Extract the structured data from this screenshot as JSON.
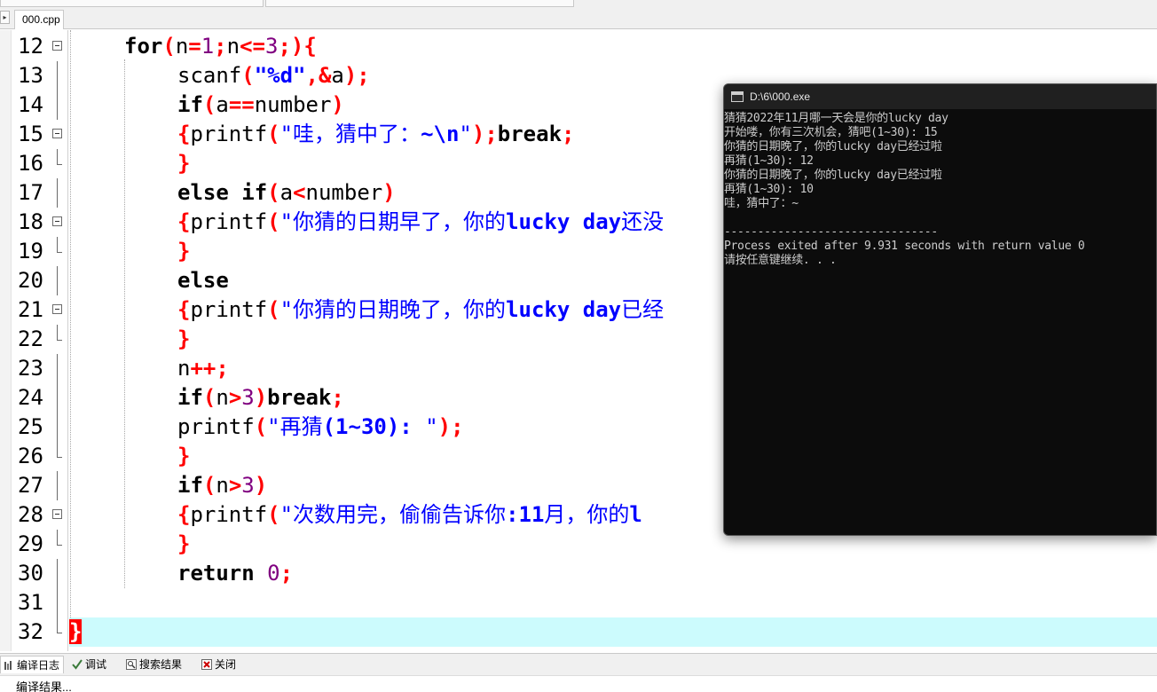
{
  "editor": {
    "file_tab": "000.cpp",
    "lines": [
      {
        "n": "12"
      },
      {
        "n": "13"
      },
      {
        "n": "14"
      },
      {
        "n": "15"
      },
      {
        "n": "16"
      },
      {
        "n": "17"
      },
      {
        "n": "18"
      },
      {
        "n": "19"
      },
      {
        "n": "20"
      },
      {
        "n": "21"
      },
      {
        "n": "22"
      },
      {
        "n": "23"
      },
      {
        "n": "24"
      },
      {
        "n": "25"
      },
      {
        "n": "26"
      },
      {
        "n": "27"
      },
      {
        "n": "28"
      },
      {
        "n": "29"
      },
      {
        "n": "30"
      },
      {
        "n": "31"
      },
      {
        "n": "32"
      }
    ],
    "code": {
      "l12_for": "for",
      "l12_open": "(",
      "l12_n": "n",
      "l12_eq": "=",
      "l12_1": "1",
      "l12_semi1": ";",
      "l12_n2": "n",
      "l12_le": "<=",
      "l12_3": "3",
      "l12_semi2": ";)",
      "l12_brace": "{",
      "l13_scanf": "scanf",
      "l13_open": "(",
      "l13_str": "\"%d\"",
      "l13_comma": ",&",
      "l13_a": "a",
      "l13_close": ");",
      "l14_if": "if",
      "l14_open": "(",
      "l14_a": "a",
      "l14_eq": "==",
      "l14_number": "number",
      "l14_close": ")",
      "l15_brace": "{",
      "l15_printf": "printf",
      "l15_open": "(",
      "l15_str_a": "\"哇，猜中了：",
      "l15_str_b": "~\\n",
      "l15_str_c": "\"",
      "l15_close": ");",
      "l15_break": "break",
      "l15_semi": ";",
      "l16_brace": "}",
      "l17_else": "else if",
      "l17_open": "(",
      "l17_a": "a",
      "l17_lt": "<",
      "l17_number": "number",
      "l17_close": ")",
      "l18_brace": "{",
      "l18_printf": "printf",
      "l18_open": "(",
      "l18_str_a": "\"你猜的日期早了，你的",
      "l18_str_b": "lucky day",
      "l18_str_c": "还没",
      "l19_brace": "}",
      "l20_else": "else",
      "l21_brace": "{",
      "l21_printf": "printf",
      "l21_open": "(",
      "l21_str_a": "\"你猜的日期晚了，你的",
      "l21_str_b": "lucky day",
      "l21_str_c": "已经",
      "l22_brace": "}",
      "l23_n": "n",
      "l23_pp": "++;",
      "l24_if": "if",
      "l24_open": "(",
      "l24_n": "n",
      "l24_gt": ">",
      "l24_3": "3",
      "l24_close": ")",
      "l24_break": "break",
      "l24_semi": ";",
      "l25_printf": "printf",
      "l25_open": "(",
      "l25_str_a": "\"再猜",
      "l25_str_b": "(1~30): ",
      "l25_str_c": "\"",
      "l25_close": ");",
      "l26_brace": "}",
      "l27_if": "if",
      "l27_open": "(",
      "l27_n": "n",
      "l27_gt": ">",
      "l27_3": "3",
      "l27_close": ")",
      "l28_brace": "{",
      "l28_printf": "printf",
      "l28_open": "(",
      "l28_str_a": "\"次数用完，偷偷告诉你",
      "l28_str_b": ":11",
      "l28_str_c": "月，你的",
      "l28_str_d": "l",
      "l29_brace": "}",
      "l30_return": "return",
      "l30_0": "0",
      "l30_semi": ";",
      "l32_brace": "}"
    }
  },
  "console": {
    "title": "D:\\6\\000.exe",
    "lines": [
      "猜猜2022年11月哪一天会是你的lucky day",
      "开始喽，你有三次机会，猜吧(1~30): 15",
      "你猜的日期晚了，你的lucky day已经过啦",
      "再猜(1~30): 12",
      "你猜的日期晚了，你的lucky day已经过啦",
      "再猜(1~30): 10",
      "哇，猜中了：~",
      "",
      "--------------------------------",
      "Process exited after 9.931 seconds with return value 0",
      "请按任意键继续. . ."
    ]
  },
  "bottom_panel": {
    "tabs": [
      {
        "label": "编译日志",
        "icon": "compile-log-icon"
      },
      {
        "label": "调试",
        "icon": "debug-check-icon"
      },
      {
        "label": "搜索结果",
        "icon": "search-results-icon"
      },
      {
        "label": "关闭",
        "icon": "close-icon"
      }
    ],
    "content": "编译结果..."
  }
}
